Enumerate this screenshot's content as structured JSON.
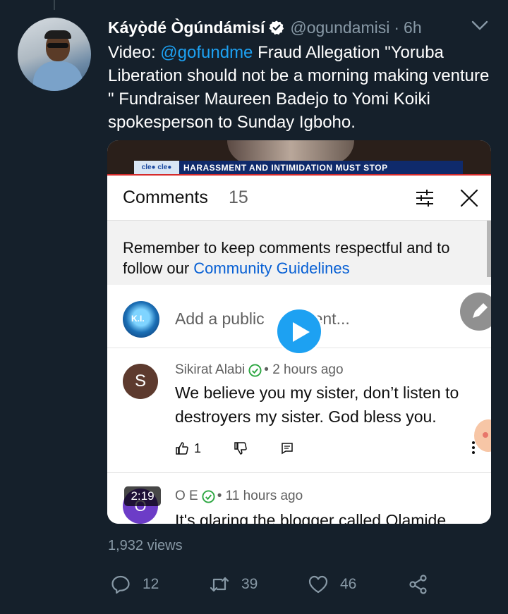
{
  "tweet": {
    "display_name": "Káyọ̀dé Ògúndámisí",
    "handle": "@ogundamisi",
    "separator": "·",
    "time": "6h",
    "text_prefix": "Video: ",
    "mention": "@gofundme",
    "text_rest": " Fraud Allegation \"Yoruba Liberation should not be a morning making venture \" Fundraiser Maureen Badejo to Yomi Koiki spokesperson to Sunday Igboho.",
    "views": "1,932 views",
    "reply_count": "12",
    "retweet_count": "39",
    "like_count": "46",
    "verified_color": "#ffffff",
    "link_color": "#1da1f2"
  },
  "video": {
    "duration": "2:19",
    "ticker_logo": "cle● cle●",
    "ticker_text": "HARASSMENT AND INTIMIDATION MUST STOP",
    "comments_title": "Comments",
    "comments_count": "15",
    "guidelines_text": "Remember to keep comments respectful and to follow our ",
    "guidelines_link": "Community Guidelines",
    "add_comment_placeholder": "Add a public comment...",
    "add_comment_shown_left": "Add a public",
    "add_comment_shown_right": "ent...",
    "my_avatar_text": "K.I.",
    "comments": [
      {
        "avatar_letter": "S",
        "author": "Sikirat Alabi",
        "time": "• 2 hours ago",
        "text": "We believe you my sister, don’t listen to destroyers my sister. God bless you.",
        "likes": "1"
      },
      {
        "avatar_letter": "O",
        "author": "O E",
        "time": "• 11 hours ago",
        "text": "It's glaring the blogger called Olamide"
      }
    ]
  },
  "icons": {
    "verified": "verified-badge-icon",
    "caret": "chevron-down-icon",
    "reply": "reply-bubble-icon",
    "retweet": "retweet-icon",
    "like": "heart-icon",
    "share": "share-icon",
    "play": "play-icon"
  }
}
